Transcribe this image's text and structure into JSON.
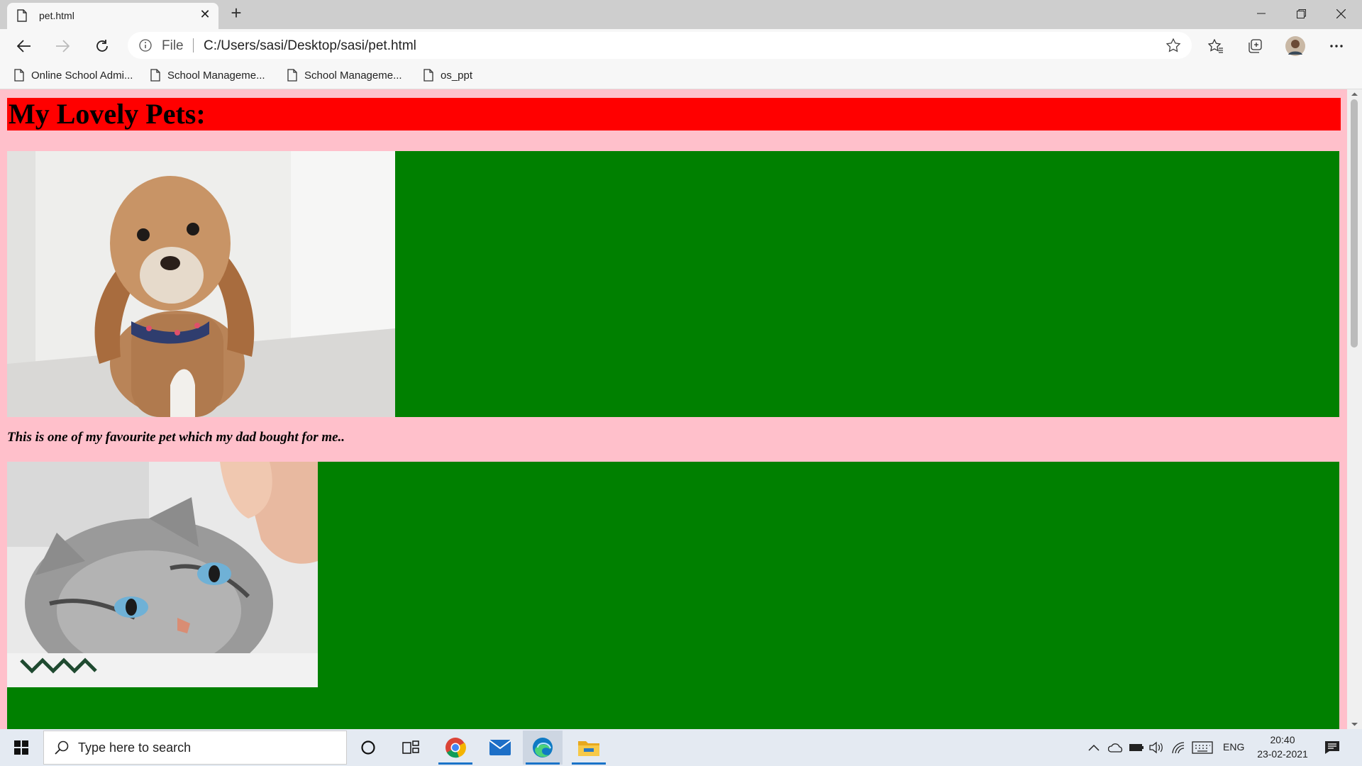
{
  "browser": {
    "tab_title": "pet.html",
    "address_scheme": "File",
    "address_url": "C:/Users/sasi/Desktop/sasi/pet.html",
    "bookmarks": [
      {
        "label": "Online School Admi..."
      },
      {
        "label": "School Manageme..."
      },
      {
        "label": "School Manageme..."
      },
      {
        "label": "os_ppt"
      }
    ]
  },
  "page": {
    "heading": "My Lovely Pets:",
    "caption": "This is one of my favourite pet which my dad bought for me..",
    "colors": {
      "background": "#ffc0cb",
      "heading_bg": "#ff0000",
      "row_bg": "#008000"
    }
  },
  "taskbar": {
    "search_placeholder": "Type here to search",
    "language": "ENG",
    "time": "20:40",
    "date": "23-02-2021"
  }
}
